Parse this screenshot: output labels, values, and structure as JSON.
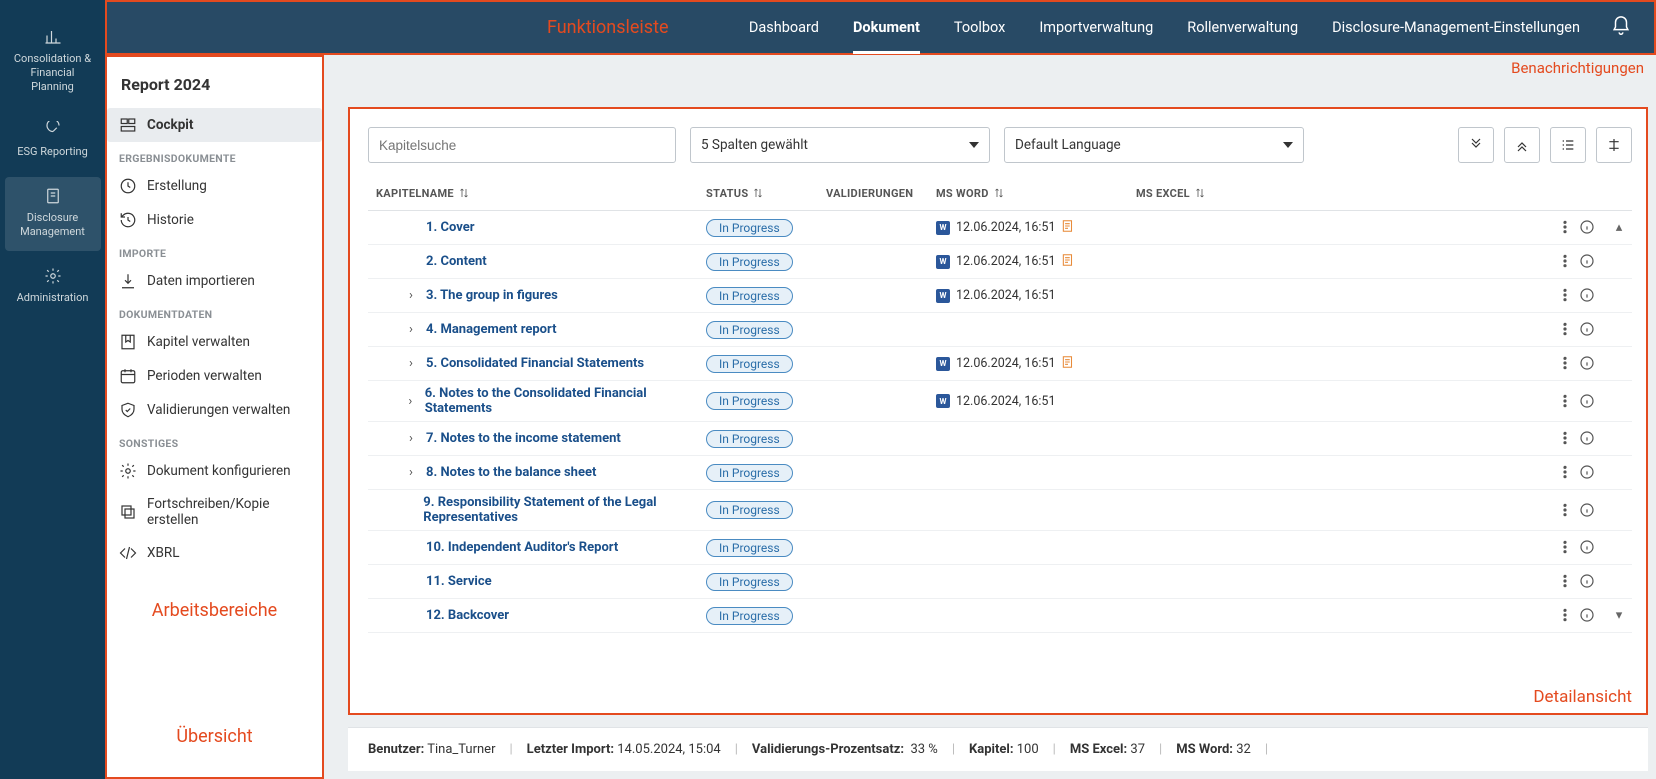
{
  "annotations": {
    "topbar": "Funktionsleiste",
    "notifications": "Benachrichtigungen",
    "workspaces": "Arbeitsbereiche",
    "overview": "Übersicht",
    "detail": "Detailansicht"
  },
  "rail": [
    {
      "label": "Consolidation & Financial Planning",
      "icon": "bar-chart"
    },
    {
      "label": "ESG Reporting",
      "icon": "gauge"
    },
    {
      "label": "Disclosure Management",
      "icon": "document-badge",
      "active": true
    },
    {
      "label": "Administration",
      "icon": "gear"
    }
  ],
  "topnav": [
    {
      "label": "Dashboard"
    },
    {
      "label": "Dokument",
      "active": true
    },
    {
      "label": "Toolbox"
    },
    {
      "label": "Importverwaltung"
    },
    {
      "label": "Rollenverwaltung"
    },
    {
      "label": "Disclosure-Management-Einstellungen"
    }
  ],
  "sidebar": {
    "title": "Report 2024",
    "groups": [
      {
        "items": [
          {
            "label": "Cockpit",
            "icon": "cockpit",
            "active": true
          }
        ]
      },
      {
        "title": "ERGEBNISDOKUMENTE",
        "items": [
          {
            "label": "Erstellung",
            "icon": "generate"
          },
          {
            "label": "Historie",
            "icon": "history"
          }
        ]
      },
      {
        "title": "IMPORTE",
        "items": [
          {
            "label": "Daten importieren",
            "icon": "import"
          }
        ]
      },
      {
        "title": "DOKUMENTDATEN",
        "items": [
          {
            "label": "Kapitel verwalten",
            "icon": "bookmark"
          },
          {
            "label": "Perioden verwalten",
            "icon": "calendar"
          },
          {
            "label": "Validierungen verwalten",
            "icon": "shield"
          }
        ]
      },
      {
        "title": "SONSTIGES",
        "items": [
          {
            "label": "Dokument konfigurieren",
            "icon": "gear"
          },
          {
            "label": "Fortschreiben/Kopie erstellen",
            "icon": "copy"
          },
          {
            "label": "XBRL",
            "icon": "code"
          }
        ]
      }
    ]
  },
  "controls": {
    "search_placeholder": "Kapitelsuche",
    "columns_select": "5 Spalten gewählt",
    "language_select": "Default Language"
  },
  "table": {
    "headers": {
      "chapter": "KAPITELNAME",
      "status": "STATUS",
      "validations": "VALIDIERUNGEN",
      "word": "MS WORD",
      "excel": "MS EXCEL"
    },
    "rows": [
      {
        "name": "1. Cover",
        "status": "In Progress",
        "word_ts": "12.06.2024, 16:51",
        "word": true,
        "attach": true,
        "scroll": "up"
      },
      {
        "name": "2. Content",
        "status": "In Progress",
        "word_ts": "12.06.2024, 16:51",
        "word": true,
        "attach": true
      },
      {
        "name": "3. The group in figures",
        "status": "In Progress",
        "word_ts": "12.06.2024, 16:51",
        "word": true,
        "expand": true,
        "bold": true
      },
      {
        "name": "4. Management report",
        "status": "In Progress",
        "expand": true,
        "bold": true
      },
      {
        "name": "5. Consolidated Financial Statements",
        "status": "In Progress",
        "word_ts": "12.06.2024, 16:51",
        "word": true,
        "attach": true,
        "expand": true,
        "bold": true
      },
      {
        "name": "6. Notes to the Consolidated Financial Statements",
        "status": "In Progress",
        "word_ts": "12.06.2024, 16:51",
        "word": true,
        "expand": true,
        "bold": true
      },
      {
        "name": "7. Notes to the income statement",
        "status": "In Progress",
        "expand": true,
        "bold": true
      },
      {
        "name": "8. Notes to the balance sheet",
        "status": "In Progress",
        "expand": true,
        "bold": true
      },
      {
        "name": "9. Responsibility Statement of the Legal Representatives",
        "status": "In Progress"
      },
      {
        "name": "10. Independent Auditor's Report",
        "status": "In Progress"
      },
      {
        "name": "11. Service",
        "status": "In Progress"
      },
      {
        "name": "12. Backcover",
        "status": "In Progress",
        "scroll": "down"
      }
    ]
  },
  "footer": {
    "user_label": "Benutzer:",
    "user": "Tina_Turner",
    "import_label": "Letzter Import:",
    "import": "14.05.2024, 15:04",
    "valid_label": "Validierungs-Prozentsatz:",
    "valid": "33 %",
    "chapters_label": "Kapitel:",
    "chapters": "100",
    "excel_label": "MS Excel:",
    "excel": "37",
    "word_label": "MS Word:",
    "word": "32"
  }
}
